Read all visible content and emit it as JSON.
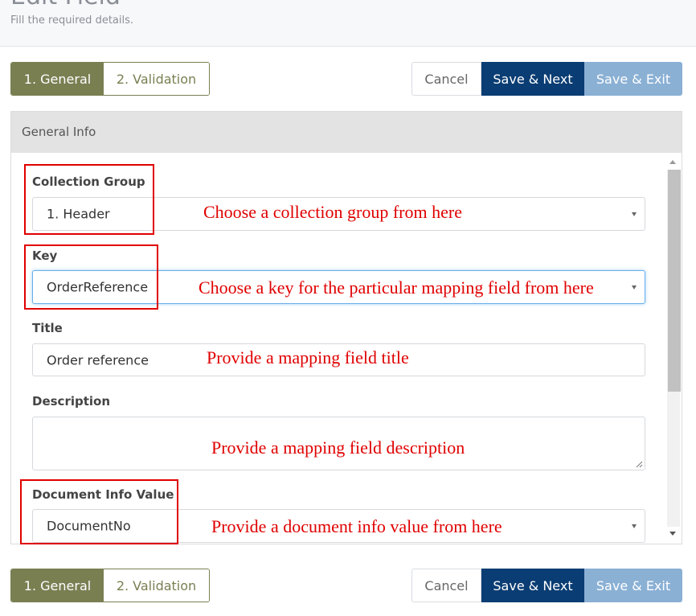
{
  "header": {
    "title": "Edit Field",
    "subtitle": "Fill the required details."
  },
  "toolbar": {
    "tabs": [
      {
        "label": "1. General",
        "active": true
      },
      {
        "label": "2. Validation",
        "active": false
      }
    ],
    "cancel_label": "Cancel",
    "save_next_label": "Save & Next",
    "save_exit_label": "Save & Exit"
  },
  "panel": {
    "title": "General Info",
    "fields": {
      "collection_group": {
        "label": "Collection Group",
        "value": "1. Header"
      },
      "key": {
        "label": "Key",
        "value": "OrderReference"
      },
      "title": {
        "label": "Title",
        "value": "Order reference"
      },
      "description": {
        "label": "Description",
        "value": ""
      },
      "document_info_value": {
        "label": "Document Info Value",
        "value": "DocumentNo"
      }
    }
  },
  "annotations": {
    "collection_group": "Choose a collection group from here",
    "key": "Choose a key for the particular mapping field from here",
    "title": "Provide a mapping field title",
    "description": "Provide a mapping field description",
    "document_info_value": "Provide a document info value from here"
  },
  "colors": {
    "tab_active": "#7a7f52",
    "save_next": "#0a3d73",
    "save_exit": "#8ab0d4",
    "annotation": "#e00000",
    "focus_border": "#66afe9"
  }
}
